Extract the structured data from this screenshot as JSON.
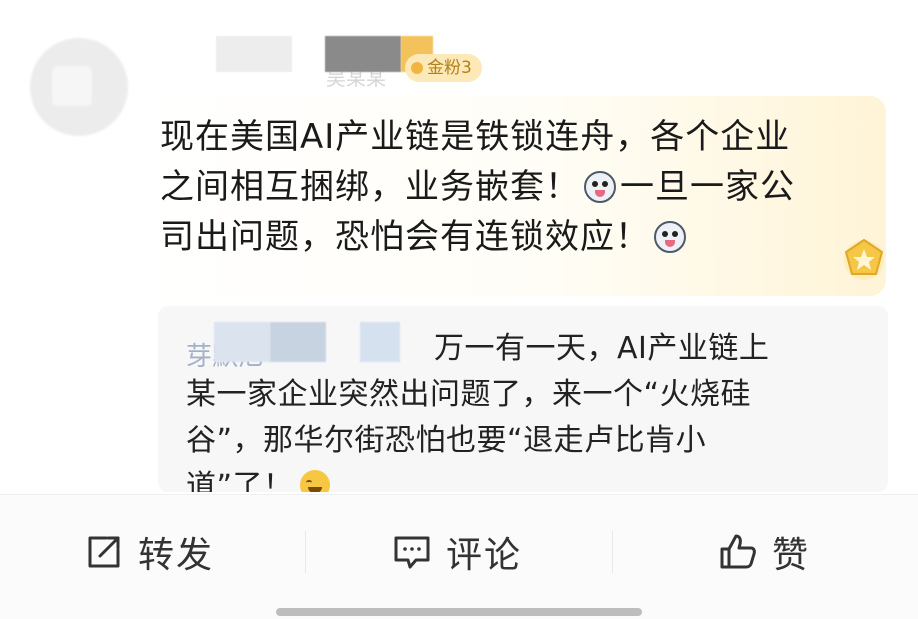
{
  "user": {
    "name_obscured": "吴某某",
    "fan_badge": "金粉3"
  },
  "comment": {
    "line1": "现在美国AI产业链是铁锁连舟，各个企业",
    "line2a": "之间相互捆绑，业务嵌套！",
    "line2b": "一旦一家公",
    "line3": "司出问题，恐怕会有连锁效应！",
    "emoji_icon": "dog-face-emoji"
  },
  "reply": {
    "handle_obscured": "芽默尼",
    "line1": "万一有一天，AI产业链上",
    "line2": "某一家企业突然出问题了，来一个“火烧硅",
    "line3": "谷”，那华尔街恐怕也要“退走卢比肯小",
    "line4": "道”了！",
    "emoji_icon": "grin-emoji"
  },
  "actions": {
    "forward": "转发",
    "comment": "评论",
    "like": "赞"
  },
  "colors": {
    "badge_bg": "#fde9b8",
    "badge_text": "#b28119",
    "reply_bg": "#f7f7f8"
  }
}
